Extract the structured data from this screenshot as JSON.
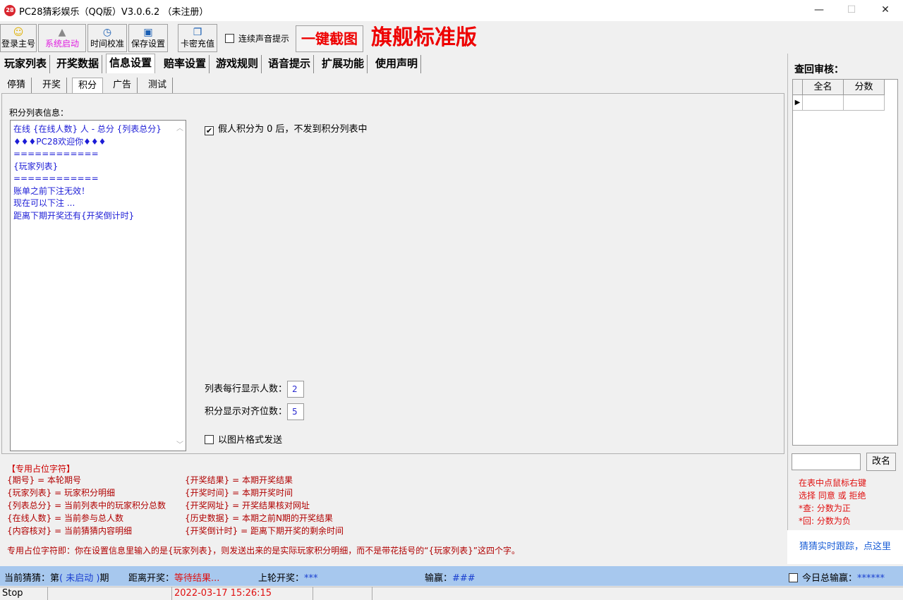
{
  "window": {
    "title": "PC28猜彩娱乐（QQ版）V3.0.6.2 （未注册）",
    "icon_text": "28",
    "minimize": "—",
    "maximize": "☐",
    "close": "✕"
  },
  "toolbar": {
    "login_label": "登录主号",
    "start_label": "系统启动",
    "time_label": "时间校准",
    "save_label": "保存设置",
    "card_label": "卡密充值",
    "sound_label": "连续声音提示",
    "screenshot_label": "一键截图",
    "edition_label": "旗舰标准版",
    "start_color": "#e020e0"
  },
  "main_tabs": [
    "玩家列表",
    "开奖数据",
    "信息设置",
    "赔率设置",
    "游戏规则",
    "语音提示",
    "扩展功能",
    "使用声明"
  ],
  "sub_tabs": [
    "停猜",
    "开奖",
    "积分",
    "广告",
    "测试"
  ],
  "score": {
    "list_title": "积分列表信息：",
    "lines": [
      "在线 {在线人数} 人 - 总分 {列表总分}",
      "♦♦♦PC28欢迎你♦♦♦",
      "============",
      "{玩家列表}",
      "============",
      "账单之前下注无效！",
      "现在可以下注 ...",
      "距离下期开奖还有{开奖倒计时}"
    ],
    "fake_zero_label": "假人积分为 0 后，不发到积分列表中",
    "fake_zero_checked": "✔",
    "per_row_label": "列表每行显示人数：",
    "per_row_value": "2",
    "align_label": "积分显示对齐位数：",
    "align_value": "5",
    "image_send_label": "以图片格式发送"
  },
  "placeholders": {
    "title": "【专用占位字符】",
    "left": [
      "{期号} = 本轮期号",
      "{玩家列表} = 玩家积分明细",
      "{列表总分} = 当前列表中的玩家积分总数",
      "{在线人数} = 当前参与总人数",
      "{内容核对} = 当前猜猜内容明细"
    ],
    "right": [
      "{开奖结果} = 本期开奖结果",
      "{开奖时间} = 本期开奖时间",
      "{开奖网址} = 开奖结果核对网址",
      "{历史数据} = 本期之前N期的开奖结果",
      "{开奖倒计时} = 距离下期开奖的剩余时间"
    ],
    "note": "专用占位字符即：你在设置信息里输入的是{玩家列表}，则发送出来的是实际玩家积分明细，而不是带花括号的“{玩家列表}”这四个字。"
  },
  "audit": {
    "title": "查回审核：",
    "col_name": "全名",
    "col_score": "分数",
    "row_pointer": "▶",
    "rename_label": "改名",
    "tips": [
      "在表中点鼠标右键",
      "选择 同意 或 拒绝",
      "*查: 分数为正",
      "*回: 分数为负"
    ],
    "track_link": "猜猜实时跟踪，点这里"
  },
  "status": {
    "current_prefix": "当前猜猜：第",
    "current_state": "( 未启动 )",
    "current_suffix": "期",
    "countdown_label": "距离开奖：",
    "countdown_value": "等待结果...",
    "last_label": "上轮开奖：",
    "last_value": "***",
    "winloss_label": "输赢：",
    "winloss_value": "###",
    "daily_label": "今日总输赢：",
    "daily_value": "******"
  },
  "strip": {
    "state": "Stop",
    "datetime": "2022-03-17 15:26:15"
  }
}
